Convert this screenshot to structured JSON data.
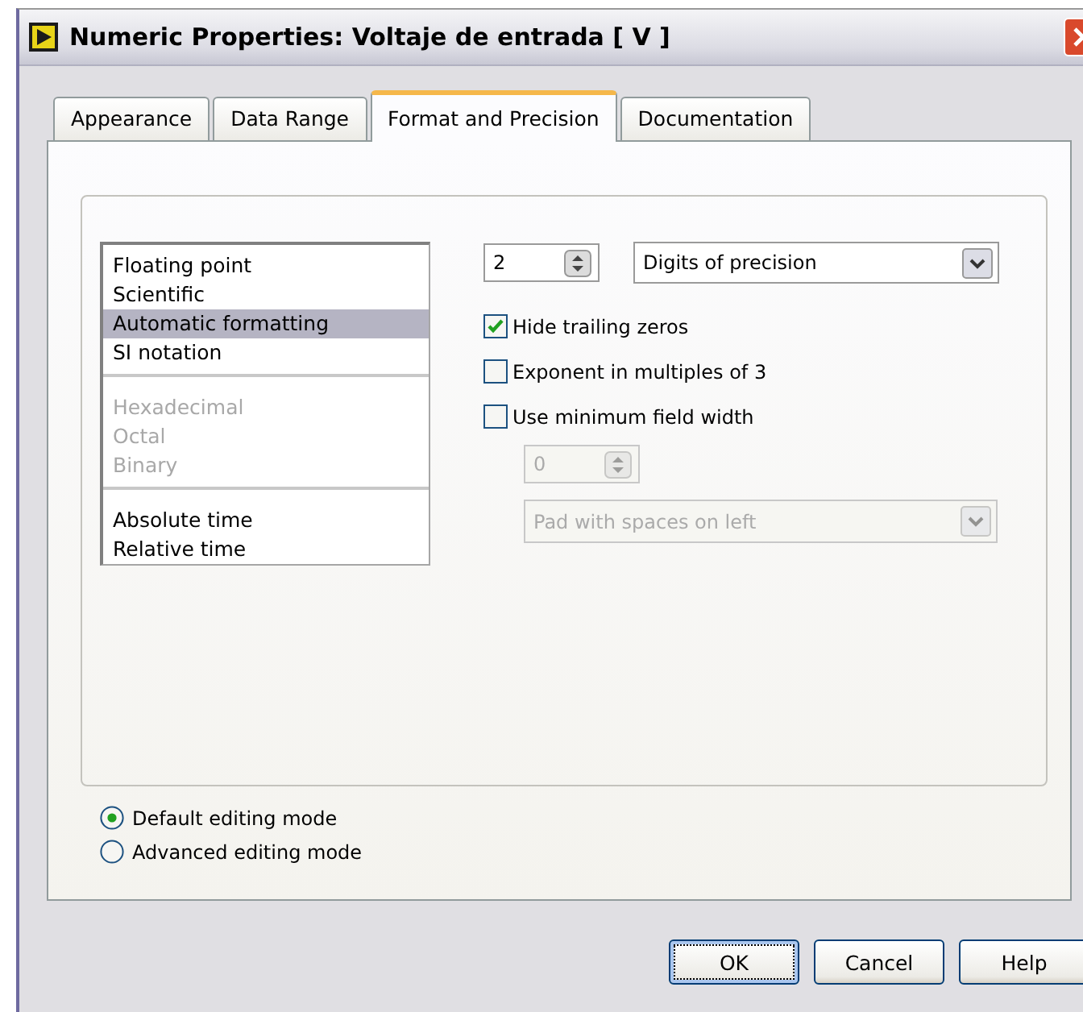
{
  "window": {
    "title": "Numeric Properties: Voltaje de entrada [ V ]"
  },
  "tabs": [
    {
      "label": "Appearance",
      "selected": false
    },
    {
      "label": "Data Range",
      "selected": false
    },
    {
      "label": "Format and Precision",
      "selected": true
    },
    {
      "label": "Documentation",
      "selected": false
    }
  ],
  "format_list": {
    "groups": [
      [
        {
          "label": "Floating point",
          "selected": false,
          "disabled": false
        },
        {
          "label": "Scientific",
          "selected": false,
          "disabled": false
        },
        {
          "label": "Automatic formatting",
          "selected": true,
          "disabled": false
        },
        {
          "label": "SI notation",
          "selected": false,
          "disabled": false
        }
      ],
      [
        {
          "label": "Hexadecimal",
          "selected": false,
          "disabled": true
        },
        {
          "label": "Octal",
          "selected": false,
          "disabled": true
        },
        {
          "label": "Binary",
          "selected": false,
          "disabled": true
        }
      ],
      [
        {
          "label": "Absolute time",
          "selected": false,
          "disabled": false
        },
        {
          "label": "Relative time",
          "selected": false,
          "disabled": false
        }
      ]
    ]
  },
  "precision": {
    "value": "2",
    "disabled": false
  },
  "precision_type": {
    "value": "Digits of precision",
    "disabled": false
  },
  "checkboxes": [
    {
      "label": "Hide trailing zeros",
      "checked": true
    },
    {
      "label": "Exponent in multiples of 3",
      "checked": false
    },
    {
      "label": "Use minimum field width",
      "checked": false
    }
  ],
  "field_width": {
    "value": "0",
    "disabled": true
  },
  "padding": {
    "value": "Pad with spaces on left",
    "disabled": true
  },
  "editing_modes": [
    {
      "label": "Default editing mode",
      "selected": true
    },
    {
      "label": "Advanced editing mode",
      "selected": false
    }
  ],
  "buttons": [
    {
      "label": "OK",
      "kind": "default"
    },
    {
      "label": "Cancel",
      "kind": "normal"
    },
    {
      "label": "Help",
      "kind": "normal"
    }
  ]
}
